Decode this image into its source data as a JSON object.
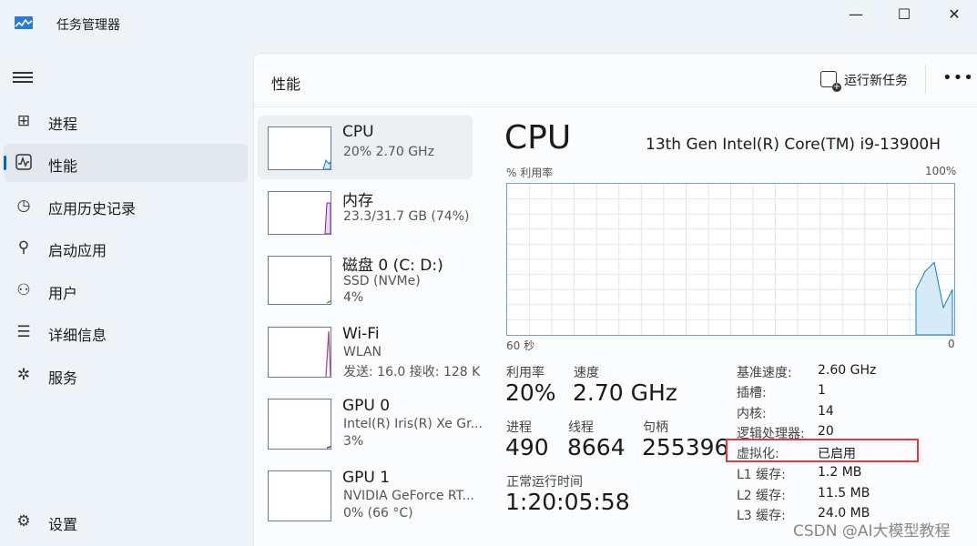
{
  "window": {
    "title": "任务管理器"
  },
  "controls": {
    "minimize": "—",
    "maximize": "☐",
    "close": "✕"
  },
  "sidebar": {
    "items": [
      {
        "label": "进程",
        "icon": "processes-icon",
        "active": false
      },
      {
        "label": "性能",
        "icon": "performance-icon",
        "active": true
      },
      {
        "label": "应用历史记录",
        "icon": "history-icon",
        "active": false
      },
      {
        "label": "启动应用",
        "icon": "startup-icon",
        "active": false
      },
      {
        "label": "用户",
        "icon": "users-icon",
        "active": false
      },
      {
        "label": "详细信息",
        "icon": "details-icon",
        "active": false
      },
      {
        "label": "服务",
        "icon": "services-icon",
        "active": false
      }
    ],
    "settings_label": "设置"
  },
  "header": {
    "title": "性能",
    "run_task": "运行新任务",
    "more": "•••"
  },
  "resources": [
    {
      "name": "CPU",
      "sub1": "20%  2.70 GHz",
      "sub2": "",
      "sub3": "",
      "active": true
    },
    {
      "name": "内存",
      "sub1": "23.3/31.7 GB (74%)",
      "sub2": "",
      "sub3": "",
      "active": false
    },
    {
      "name": "磁盘 0 (C: D:)",
      "sub1": "SSD (NVMe)",
      "sub2": "4%",
      "sub3": "",
      "active": false
    },
    {
      "name": "Wi-Fi",
      "sub1": "WLAN",
      "sub2": "发送: 16.0  接收: 128 K",
      "sub3": "",
      "active": false
    },
    {
      "name": "GPU 0",
      "sub1": "Intel(R) Iris(R) Xe Gr...",
      "sub2": "3%",
      "sub3": "",
      "active": false
    },
    {
      "name": "GPU 1",
      "sub1": "NVIDIA GeForce RT...",
      "sub2": "0% (66 °C)",
      "sub3": "",
      "active": false
    }
  ],
  "detail": {
    "title": "CPU",
    "processor": "13th Gen Intel(R) Core(TM) i9-13900H",
    "graph": {
      "top_left": "% 利用率",
      "top_right": "100%",
      "bottom_left": "60 秒",
      "bottom_right": "0",
      "recent_utilization": [
        0.3,
        0.42,
        0.48,
        0.18,
        0.3
      ]
    },
    "stats": [
      {
        "label": "利用率",
        "value": "20%"
      },
      {
        "label": "速度",
        "value": "2.70 GHz"
      },
      {
        "label": "进程",
        "value": "490"
      },
      {
        "label": "线程",
        "value": "8664"
      },
      {
        "label": "句柄",
        "value": "255396"
      },
      {
        "label": "正常运行时间",
        "value": "1:20:05:58"
      }
    ],
    "specs": [
      {
        "label": "基准速度:",
        "value": "2.60 GHz"
      },
      {
        "label": "插槽:",
        "value": "1"
      },
      {
        "label": "内核:",
        "value": "14"
      },
      {
        "label": "逻辑处理器:",
        "value": "20"
      },
      {
        "label": "虚拟化:",
        "value": "已启用"
      },
      {
        "label": "L1 缓存:",
        "value": "1.2 MB"
      },
      {
        "label": "L2 缓存:",
        "value": "11.5 MB"
      },
      {
        "label": "L3 缓存:",
        "value": "24.0 MB"
      }
    ]
  },
  "watermark": "CSDN @AI大模型教程",
  "colors": {
    "accent": "#0067c0",
    "cpu_graph": "#117dbb",
    "highlight": "#e5383b",
    "wifi_line": "#a74f8a"
  }
}
